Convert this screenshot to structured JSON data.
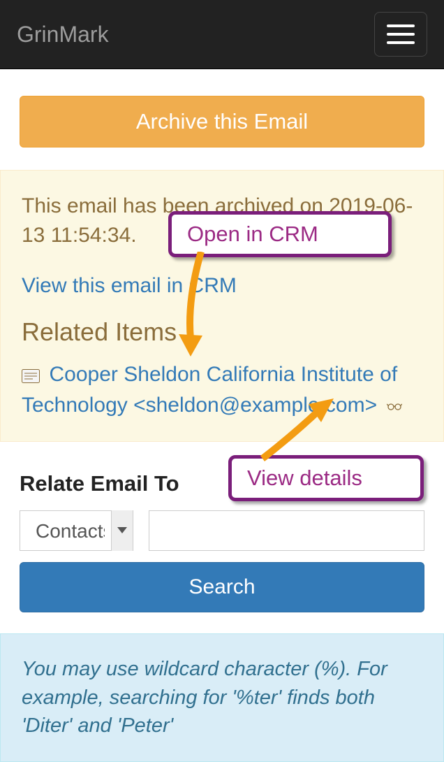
{
  "header": {
    "brand": "GrinMark"
  },
  "archive_button": "Archive this Email",
  "info": {
    "archived_msg": "This email has been archived on 2019-06-13 11:54:34.",
    "view_link": "View this email in CRM",
    "related_heading": "Related Items",
    "related_item": "Cooper Sheldon California Institute of Technology <sheldon@example.com>"
  },
  "relate": {
    "heading": "Relate Email To",
    "select_value": "Contacts",
    "search_value": "",
    "search_button": "Search"
  },
  "hint": "You may use wildcard character (%). For example, searching for '%ter' finds both 'Diter' and 'Peter'",
  "callouts": {
    "open_in_crm": "Open in CRM",
    "view_details": "View details"
  }
}
